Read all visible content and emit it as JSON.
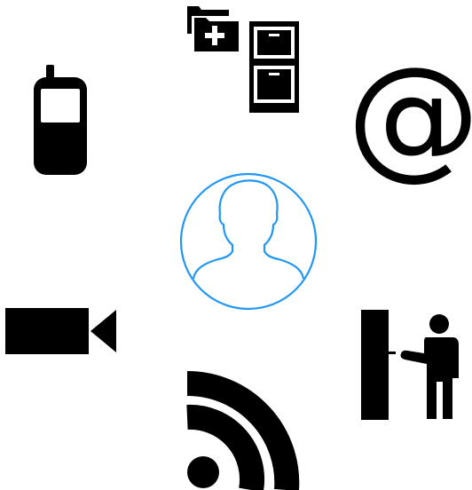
{
  "canvas": {
    "background": "#ffffff",
    "icon_color": "#000000",
    "accent_color": "#2196f3"
  },
  "icons": [
    {
      "name": "user-avatar-icon",
      "role": "center"
    },
    {
      "name": "folder-cabinet-icon",
      "role": "satellite"
    },
    {
      "name": "mobile-phone-icon",
      "role": "satellite"
    },
    {
      "name": "at-sign-icon",
      "role": "satellite",
      "glyph": "@"
    },
    {
      "name": "video-camera-icon",
      "role": "satellite"
    },
    {
      "name": "rss-feed-icon",
      "role": "satellite"
    },
    {
      "name": "person-doorbell-icon",
      "role": "satellite"
    }
  ]
}
